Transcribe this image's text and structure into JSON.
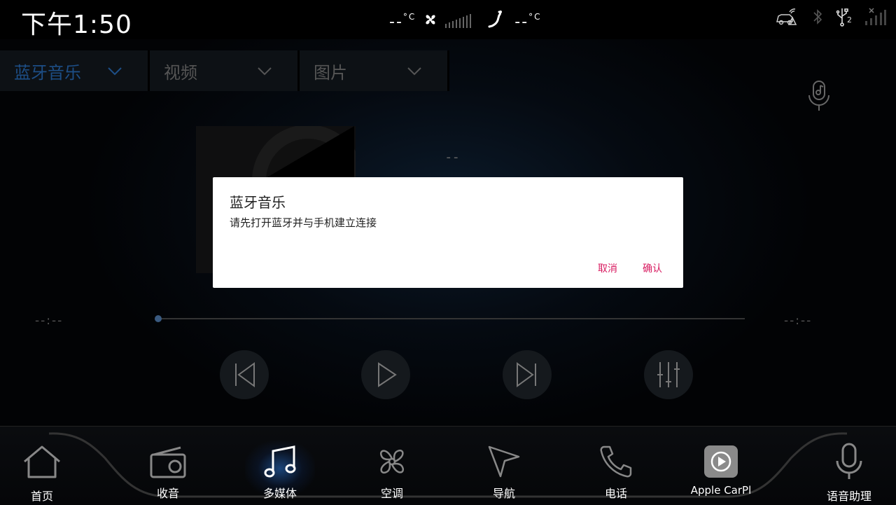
{
  "status": {
    "time": "下午1:50",
    "temp_left": "--",
    "temp_right": "--",
    "temp_unit": "°C",
    "usb_badge": "2"
  },
  "media_tabs": [
    {
      "label": "蓝牙音乐",
      "active": true
    },
    {
      "label": "视频",
      "active": false
    },
    {
      "label": "图片",
      "active": false
    }
  ],
  "player": {
    "song_title": "--",
    "elapsed": "--:--",
    "duration": "--:--",
    "progress": 0
  },
  "dialog": {
    "title": "蓝牙音乐",
    "message": "请先打开蓝牙并与手机建立连接",
    "cancel": "取消",
    "confirm": "确认"
  },
  "dock": {
    "home": "首页",
    "radio": "收音",
    "media": "多媒体",
    "climate": "空调",
    "nav": "导航",
    "phone": "电话",
    "carplay": "Apple CarPl",
    "voice": "语音助理"
  },
  "colors": {
    "accent_tab": "#1d4e86",
    "dialog_button": "#d81b60",
    "active_glow": "#328cff"
  }
}
